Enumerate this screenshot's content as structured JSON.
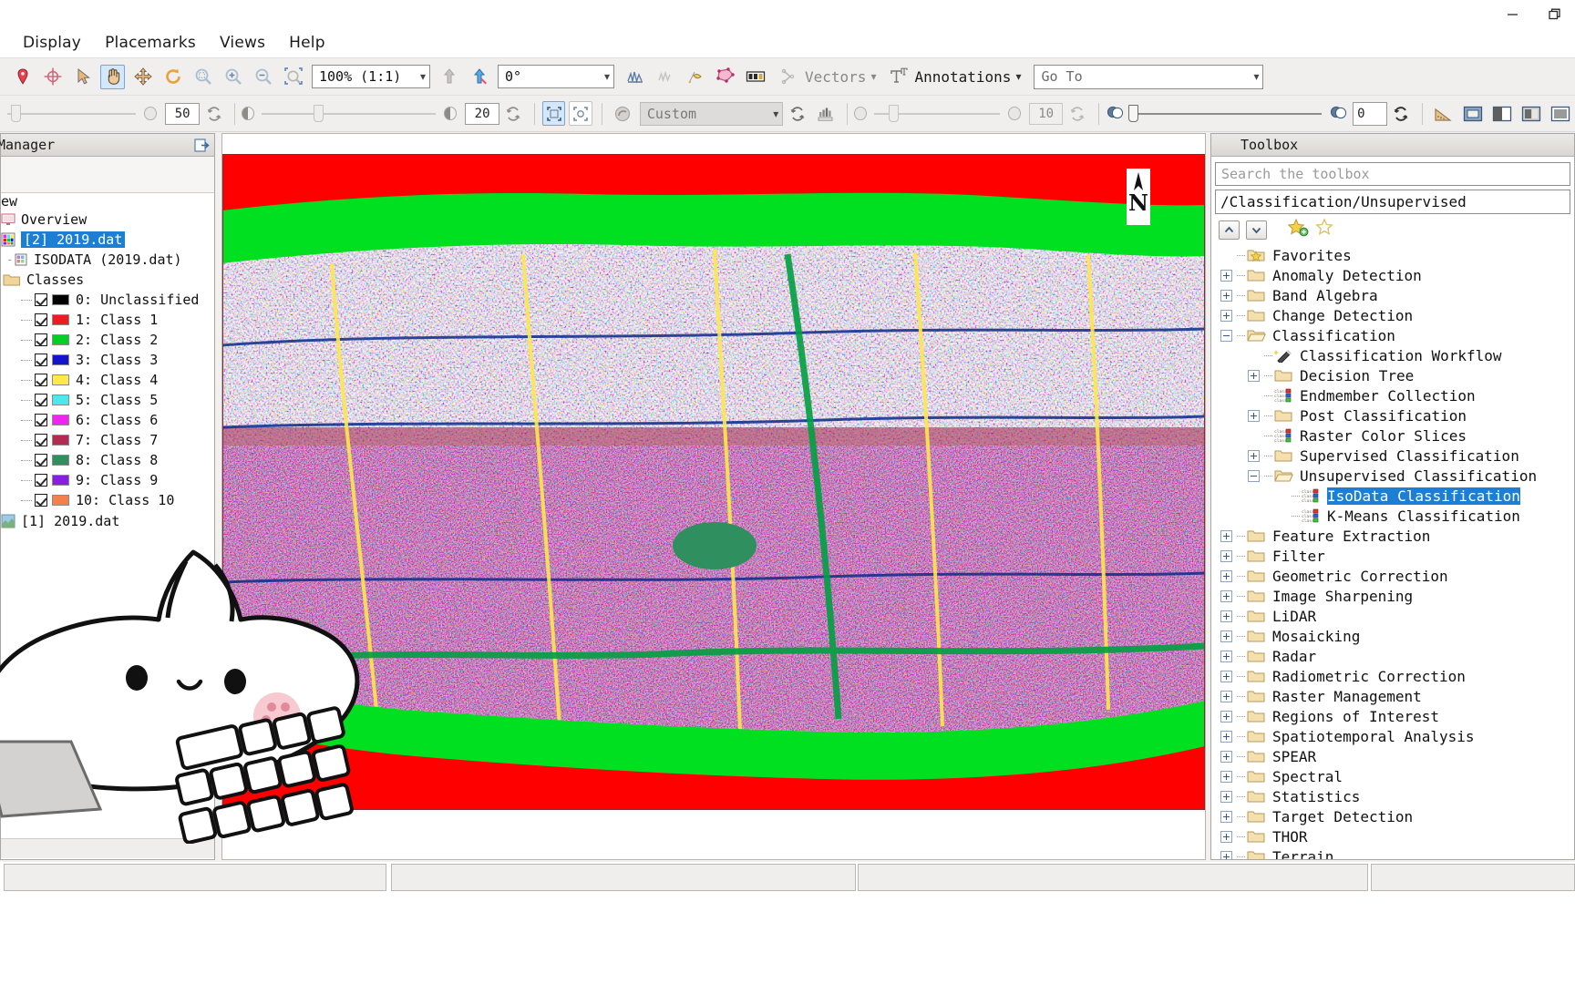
{
  "window": {
    "minimize_icon": "minimize-icon",
    "restore_icon": "restore-icon"
  },
  "menubar": {
    "items": [
      {
        "label": "Display"
      },
      {
        "label": "Placemarks"
      },
      {
        "label": "Views"
      },
      {
        "label": "Help"
      }
    ]
  },
  "toolbar_row1": {
    "icons": [
      "placemark-pin-icon",
      "crosshair-target-icon",
      "arrow-select-icon",
      "pan-hand-icon",
      "fly-move-icon",
      "rotate-icon",
      "zoom-fit-icon",
      "zoom-in-icon",
      "zoom-out-icon",
      "zoom-to-selection-icon"
    ],
    "zoom_value": "100%  (1:1)",
    "after_icons": [
      "raise-layer-icon",
      "lower-layer-icon"
    ],
    "rotation_value": "0°",
    "icons2": [
      "spectral-profile-icon",
      "horizontal-profile-icon",
      "vertical-profile-icon",
      "roi-tool-icon",
      "pixel-locator-icon"
    ],
    "vectors_label": "Vectors",
    "vectors_icon": "vectors-icon",
    "annotations_label": "Annotations",
    "annotations_icon": "annotations-icon",
    "goto_placeholder": "Go To",
    "goto_value": ""
  },
  "toolbar_row2": {
    "brightness_icon": "brightness-icon",
    "transparency_value": "50",
    "transparency_reset_icon": "reset-icon",
    "contrast_icon": "contrast-icon",
    "contrast_value": "20",
    "contrast_reset_icon": "reset-icon",
    "fit_icons": [
      "fit-to-window-icon",
      "fit-to-data-icon"
    ],
    "stretch_icon": "stretch-icon",
    "stretch_value": "Custom",
    "stretch_reset_icon": "reset-icon",
    "histogram_icon": "histogram-icon",
    "sharpen_icon": "sharpen-icon",
    "sharpen_value": "10",
    "sharpen_reset_icon": "reset-icon",
    "blend_icon": "blend-icon",
    "blend_value": "0",
    "blend_reset_icon": "reset-icon",
    "measure_icon": "measure-icon",
    "view_icons": [
      "portal-icon",
      "swipe-icon",
      "flicker-icon",
      "blend-view-icon"
    ]
  },
  "layer_manager": {
    "title": "Manager",
    "pin_icon": "pin-panel-icon",
    "root_label": "ew",
    "items": [
      {
        "label": "Overview",
        "icon": "monitor-icon",
        "selected": false,
        "indent": 0
      },
      {
        "label": "[2] 2019.dat",
        "icon": "raster-classified-icon",
        "selected": true,
        "indent": 0
      },
      {
        "label": "ISODATA (2019.dat)",
        "icon": "raster-icon",
        "selected": false,
        "indent": 0
      },
      {
        "label": "Classes",
        "icon": "folder-icon",
        "selected": false,
        "indent": 0
      }
    ],
    "classes": [
      {
        "index": "0",
        "label": "0: Unclassified",
        "color": "#000000",
        "checked": true
      },
      {
        "index": "1",
        "label": "1: Class 1",
        "color": "#ed1c24",
        "checked": true
      },
      {
        "index": "2",
        "label": "2: Class 2",
        "color": "#00d024",
        "checked": true
      },
      {
        "index": "3",
        "label": "3: Class 3",
        "color": "#1414c8",
        "checked": true
      },
      {
        "index": "4",
        "label": "4: Class 4",
        "color": "#ffe84a",
        "checked": true
      },
      {
        "index": "5",
        "label": "5: Class 5",
        "color": "#4ce8f0",
        "checked": true
      },
      {
        "index": "6",
        "label": "6: Class 6",
        "color": "#ee25ee",
        "checked": true
      },
      {
        "index": "7",
        "label": "7: Class 7",
        "color": "#b32a53",
        "checked": true
      },
      {
        "index": "8",
        "label": "8: Class 8",
        "color": "#2f8f5e",
        "checked": true
      },
      {
        "index": "9",
        "label": "9: Class 9",
        "color": "#8a1ee0",
        "checked": true
      },
      {
        "index": "10",
        "label": "10: Class 10",
        "color": "#f4804f",
        "checked": true
      }
    ],
    "bottom_layer": {
      "label": "[1] 2019.dat",
      "icon": "raster-rgb-icon"
    }
  },
  "view": {
    "north_arrow_label": "N",
    "north_arrow_icon": "north-arrow-icon"
  },
  "toolbox": {
    "title": "Toolbox",
    "search_placeholder": "Search the toolbox",
    "search_value": "",
    "path_value": "/Classification/Unsupervised",
    "buttons": [
      {
        "name": "collapse-up-button",
        "icon": "chevron-up-icon"
      },
      {
        "name": "expand-down-button",
        "icon": "chevron-down-icon"
      },
      {
        "name": "add-favorite-button",
        "icon": "star-add-icon"
      },
      {
        "name": "remove-favorite-button",
        "icon": "star-remove-icon"
      }
    ],
    "tree": [
      {
        "label": "Favorites",
        "indent": 0,
        "toggle": "none",
        "icon": "folder-star-icon"
      },
      {
        "label": "Anomaly Detection",
        "indent": 0,
        "toggle": "plus",
        "icon": "folder-icon"
      },
      {
        "label": "Band Algebra",
        "indent": 0,
        "toggle": "plus",
        "icon": "folder-icon"
      },
      {
        "label": "Change Detection",
        "indent": 0,
        "toggle": "plus",
        "icon": "folder-icon"
      },
      {
        "label": "Classification",
        "indent": 0,
        "toggle": "minus",
        "icon": "folder-open-icon"
      },
      {
        "label": "Classification Workflow",
        "indent": 1,
        "toggle": "none",
        "icon": "wand-icon"
      },
      {
        "label": "Decision Tree",
        "indent": 1,
        "toggle": "plus",
        "icon": "folder-icon"
      },
      {
        "label": "Endmember Collection",
        "indent": 1,
        "toggle": "none",
        "icon": "class-list-icon"
      },
      {
        "label": "Post Classification",
        "indent": 1,
        "toggle": "plus",
        "icon": "folder-icon"
      },
      {
        "label": "Raster Color Slices",
        "indent": 1,
        "toggle": "none",
        "icon": "class-list-icon"
      },
      {
        "label": "Supervised Classification",
        "indent": 1,
        "toggle": "plus",
        "icon": "folder-icon"
      },
      {
        "label": "Unsupervised Classification",
        "indent": 1,
        "toggle": "minus",
        "icon": "folder-open-icon"
      },
      {
        "label": "IsoData Classification",
        "indent": 2,
        "toggle": "none",
        "icon": "class-list-icon",
        "selected": true
      },
      {
        "label": "K-Means Classification",
        "indent": 2,
        "toggle": "none",
        "icon": "class-list-icon"
      },
      {
        "label": "Feature Extraction",
        "indent": 0,
        "toggle": "plus",
        "icon": "folder-icon"
      },
      {
        "label": "Filter",
        "indent": 0,
        "toggle": "plus",
        "icon": "folder-icon"
      },
      {
        "label": "Geometric Correction",
        "indent": 0,
        "toggle": "plus",
        "icon": "folder-icon"
      },
      {
        "label": "Image Sharpening",
        "indent": 0,
        "toggle": "plus",
        "icon": "folder-icon"
      },
      {
        "label": "LiDAR",
        "indent": 0,
        "toggle": "plus",
        "icon": "folder-icon"
      },
      {
        "label": "Mosaicking",
        "indent": 0,
        "toggle": "plus",
        "icon": "folder-icon"
      },
      {
        "label": "Radar",
        "indent": 0,
        "toggle": "plus",
        "icon": "folder-icon"
      },
      {
        "label": "Radiometric Correction",
        "indent": 0,
        "toggle": "plus",
        "icon": "folder-icon"
      },
      {
        "label": "Raster Management",
        "indent": 0,
        "toggle": "plus",
        "icon": "folder-icon"
      },
      {
        "label": "Regions of Interest",
        "indent": 0,
        "toggle": "plus",
        "icon": "folder-icon"
      },
      {
        "label": "Spatiotemporal Analysis",
        "indent": 0,
        "toggle": "plus",
        "icon": "folder-icon"
      },
      {
        "label": "SPEAR",
        "indent": 0,
        "toggle": "plus",
        "icon": "folder-icon"
      },
      {
        "label": "Spectral",
        "indent": 0,
        "toggle": "plus",
        "icon": "folder-icon"
      },
      {
        "label": "Statistics",
        "indent": 0,
        "toggle": "plus",
        "icon": "folder-icon"
      },
      {
        "label": "Target Detection",
        "indent": 0,
        "toggle": "plus",
        "icon": "folder-icon"
      },
      {
        "label": "THOR",
        "indent": 0,
        "toggle": "plus",
        "icon": "folder-icon"
      },
      {
        "label": "Terrain",
        "indent": 0,
        "toggle": "plus",
        "icon": "folder-icon"
      }
    ]
  },
  "statusbar": {
    "cells": [
      "",
      "",
      "",
      ""
    ]
  },
  "colors": {
    "selection_blue": "#1d7fd4",
    "toolbar_bg": "#f1efee",
    "panel_border": "#a8a5a2"
  }
}
